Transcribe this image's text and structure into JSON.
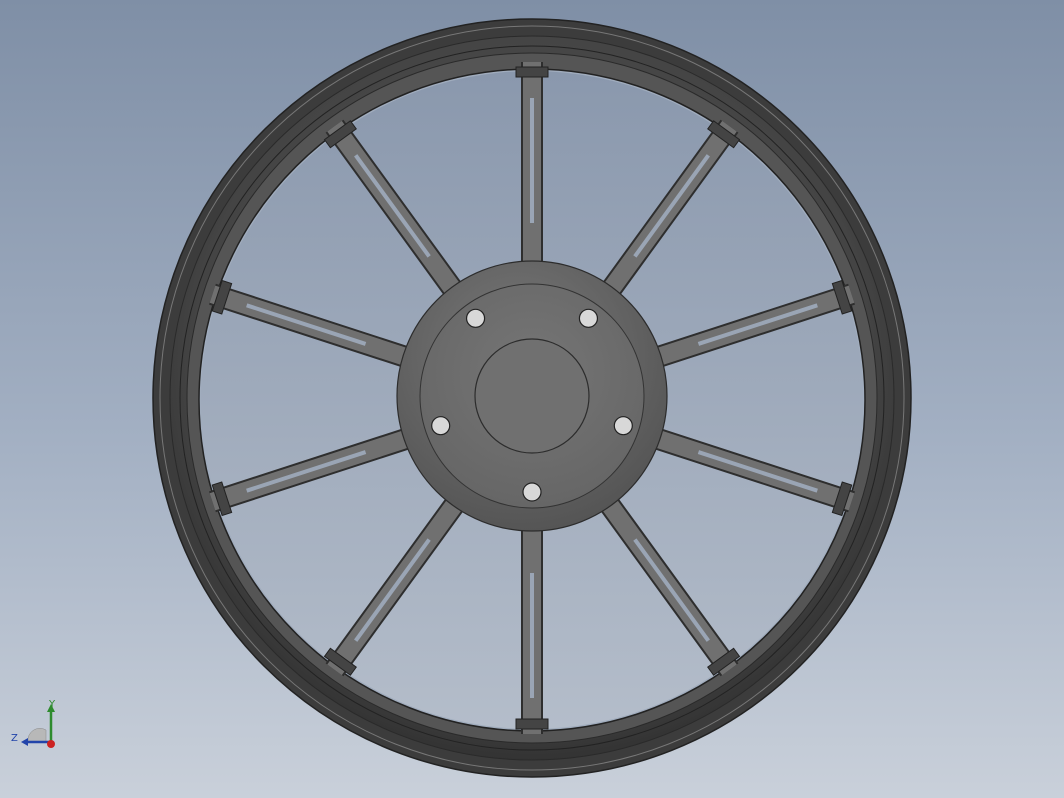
{
  "viewport": {
    "background_top": "#7f8fa6",
    "background_bottom": "#c9d0da",
    "model": "wheel-rim"
  },
  "wheel": {
    "spoke_count": 10,
    "hub_bolt_holes": 5,
    "rim_color": "#4a4a4a",
    "spoke_color": "#707070",
    "hub_color": "#6e6e6e"
  },
  "triad": {
    "y_label": "Y",
    "z_label": "Z",
    "y_color": "#2e8b2e",
    "z_color": "#2244aa",
    "x_color": "#cc2222"
  }
}
